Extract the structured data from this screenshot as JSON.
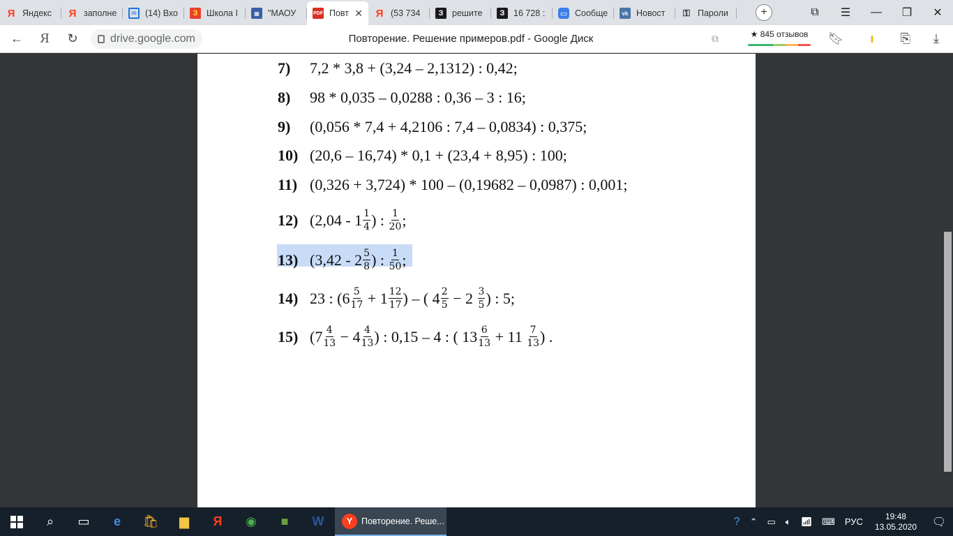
{
  "tabs": [
    {
      "label": "Яндекс",
      "icon": "yandex-icon"
    },
    {
      "label": "заполне",
      "icon": "yandex-icon"
    },
    {
      "label": "(14) Вхо",
      "icon": "mail-icon"
    },
    {
      "label": "Школа I",
      "icon": "school-icon"
    },
    {
      "label": "\"МАОУ",
      "icon": "maou-icon"
    },
    {
      "label": "Повт",
      "icon": "pdf-icon",
      "active": true
    },
    {
      "label": "(53 734",
      "icon": "yandex-icon"
    },
    {
      "label": "решите",
      "icon": "znanija-icon"
    },
    {
      "label": "16 728 :",
      "icon": "znanija-icon"
    },
    {
      "label": "Сообще",
      "icon": "chat-icon"
    },
    {
      "label": "Новост",
      "icon": "vk-icon"
    },
    {
      "label": "Пароли",
      "icon": "key-icon"
    }
  ],
  "tab_glyphs": {
    "yandex": "Я",
    "mail": "✉",
    "school": "З",
    "maou": "▦",
    "pdf": "PDF",
    "znanija": "З",
    "chat": "▭",
    "vk": "vk",
    "key": "⚿"
  },
  "address": {
    "domain": "drive.google.com",
    "title": "Повторение. Решение примеров.pdf - Google Диск",
    "reviews": "★ 845 отзывов"
  },
  "problems": [
    {
      "num": "7)",
      "parts": [
        {
          "t": "7,2 * 3,8 + (3,24 – 2,1312) : 0,42;"
        }
      ]
    },
    {
      "num": "8)",
      "parts": [
        {
          "t": "98 * 0,035 – 0,0288 : 0,36 – 3 : 16;"
        }
      ]
    },
    {
      "num": "9)",
      "parts": [
        {
          "t": "(0,056 * 7,4 + 4,2106 : 7,4 – 0,0834) : 0,375;"
        }
      ]
    },
    {
      "num": "10)",
      "parts": [
        {
          "t": "(20,6 – 16,74) * 0,1 + (23,4 + 8,95) : 100;"
        }
      ]
    },
    {
      "num": "11)",
      "parts": [
        {
          "t": "(0,326 + 3,724) * 100 – (0,19682 – 0,0987) : 0,001;"
        }
      ]
    },
    {
      "num": "12)",
      "parts": [
        {
          "t": "(2,04 - 1"
        },
        {
          "n": "1",
          "d": "4"
        },
        {
          "t": ") : "
        },
        {
          "n": "1",
          "d": "20"
        },
        {
          "t": ";"
        }
      ]
    },
    {
      "num": "13)",
      "selected": true,
      "parts": [
        {
          "t": "(3,42 - 2"
        },
        {
          "n": "5",
          "d": "8"
        },
        {
          "t": ") : "
        },
        {
          "n": "1",
          "d": "50"
        },
        {
          "t": ";"
        }
      ]
    },
    {
      "num": "14)",
      "parts": [
        {
          "t": "23 : (6"
        },
        {
          "n": "5",
          "d": "17"
        },
        {
          "t": " + 1"
        },
        {
          "n": "12",
          "d": "17"
        },
        {
          "t": ") – ( 4"
        },
        {
          "n": "2",
          "d": "5"
        },
        {
          "t": " − 2 "
        },
        {
          "n": "3",
          "d": "5"
        },
        {
          "t": ") : 5;"
        }
      ]
    },
    {
      "num": "15)",
      "parts": [
        {
          "t": "(7"
        },
        {
          "n": "4",
          "d": "13"
        },
        {
          "t": " − 4"
        },
        {
          "n": "4",
          "d": "13"
        },
        {
          "t": ") : 0,15 – 4 : ( 13"
        },
        {
          "n": "6",
          "d": "13"
        },
        {
          "t": " + 11 "
        },
        {
          "n": "7",
          "d": "13"
        },
        {
          "t": ") ."
        }
      ]
    }
  ],
  "taskbar": {
    "active_app": "Повторение. Реше...",
    "lang": "РУС",
    "time": "19:48",
    "date": "13.05.2020"
  }
}
